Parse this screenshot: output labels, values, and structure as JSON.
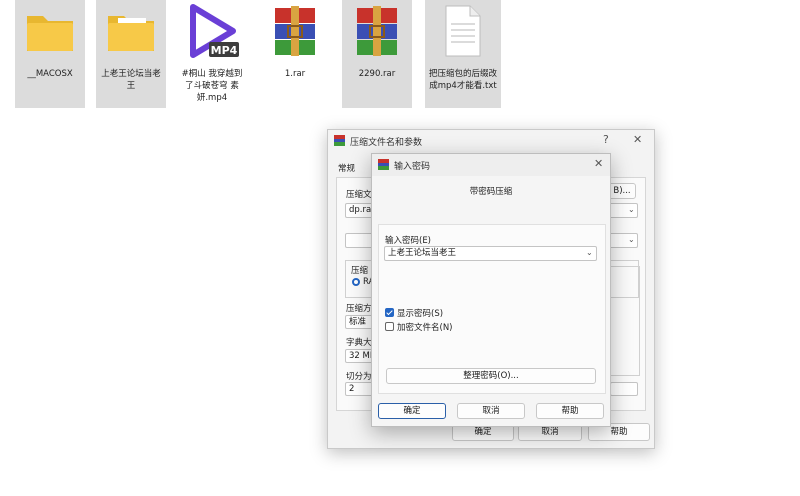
{
  "desktop": {
    "icons": [
      {
        "label": "__MACOSX",
        "type": "folder",
        "icon": "folder-icon"
      },
      {
        "label": "上老王论坛当老王",
        "type": "folder",
        "icon": "folder-icon"
      },
      {
        "label": "#桐山 我穿越到了斗破苍穹 素妍.mp4",
        "type": "video",
        "icon": "mp4-play-icon",
        "badge": "MP4"
      },
      {
        "label": "1.rar",
        "type": "rar",
        "icon": "winrar-archive-icon"
      },
      {
        "label": "2290.rar",
        "type": "rar",
        "icon": "winrar-archive-icon"
      },
      {
        "label": "把压缩包的后缀改成mp4才能看.txt",
        "type": "text",
        "icon": "text-file-icon"
      }
    ]
  },
  "archive_dialog": {
    "title": "压缩文件名和参数",
    "help_glyph": "?",
    "close_glyph": "✕",
    "tab_general": "常规",
    "archive_name_label": "压缩文",
    "archive_name_value": "dp.rar",
    "browse_label": "B)...",
    "format_group_label": "压缩",
    "format_radio_label": "RA",
    "method_label": "压缩方",
    "method_value": "标准",
    "dict_label": "字典大",
    "dict_value": "32 MB",
    "split_label": "切分为",
    "split_value": "2",
    "ok_label": "确定",
    "cancel_label": "取消",
    "help_label": "帮助"
  },
  "password_dialog": {
    "title": "输入密码",
    "close_glyph": "✕",
    "header": "带密码压缩",
    "password_label": "输入密码(E)",
    "password_value": "上老王论坛当老王",
    "show_password_label": "显示密码(S)",
    "show_password_checked": true,
    "encrypt_names_label": "加密文件名(N)",
    "encrypt_names_checked": false,
    "organize_label": "整理密码(O)...",
    "ok_label": "确定",
    "cancel_label": "取消",
    "help_label": "帮助"
  },
  "colors": {
    "folder": "#f7c948",
    "mp4_purple": "#6a3fd6",
    "rar_red": "#c8322b",
    "rar_blue": "#3a4fb4",
    "rar_green": "#3d9a3a",
    "accent": "#2466c4"
  }
}
